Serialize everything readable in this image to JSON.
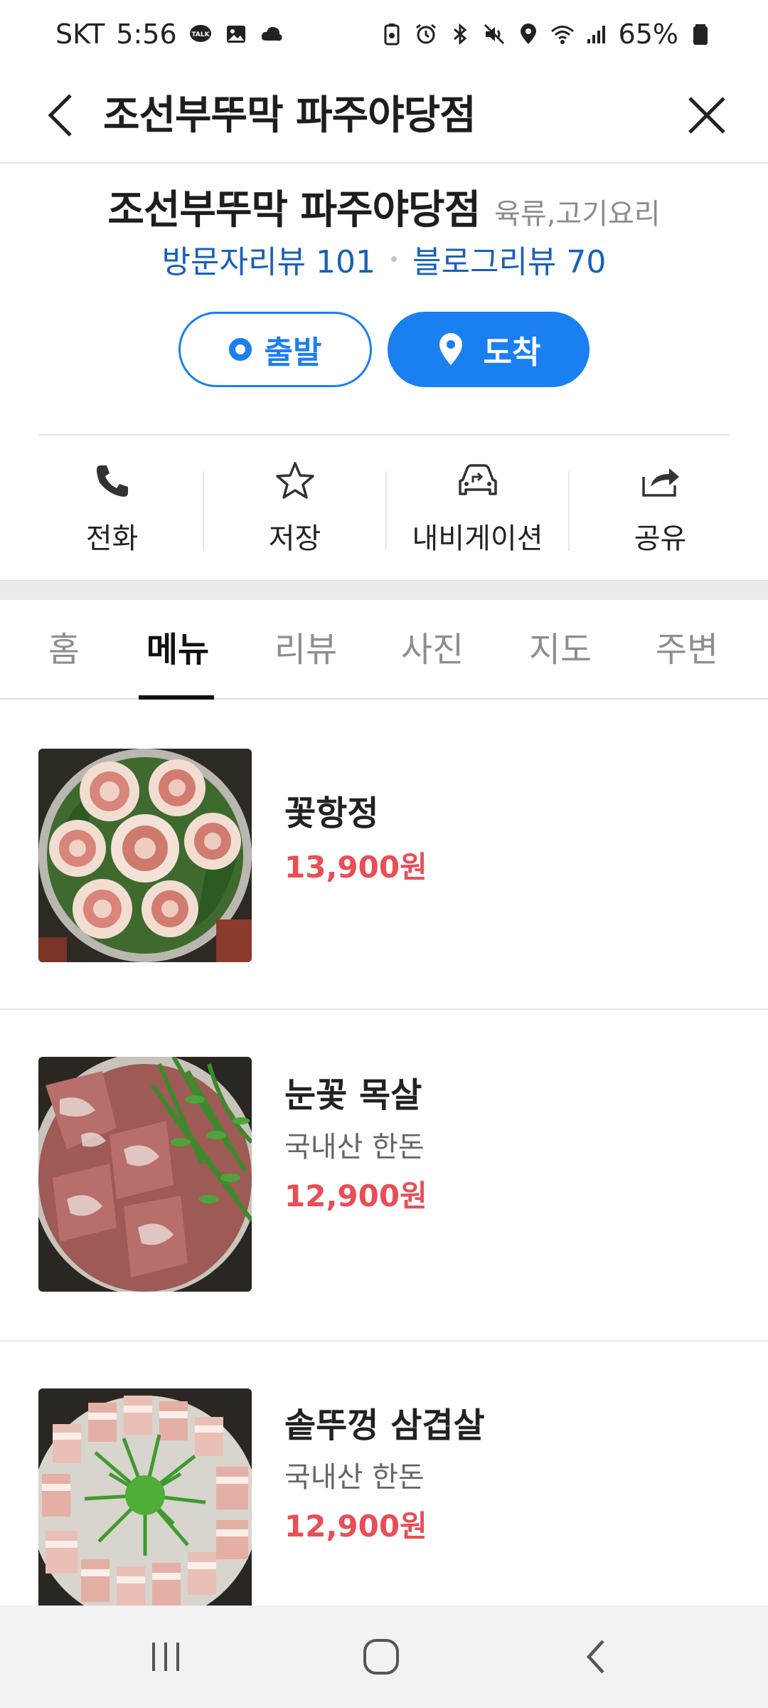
{
  "status_bar": {
    "carrier": "SKT",
    "time": "5:56",
    "battery": "65%",
    "left_icons": [
      "talk-icon",
      "gallery-icon",
      "cloud-icon"
    ],
    "right_icons": [
      "recycle-battery-icon",
      "alarm-icon",
      "bluetooth-icon",
      "mute-icon",
      "location-icon",
      "wifi-icon",
      "signal-icon",
      "battery-icon"
    ]
  },
  "header": {
    "title": "조선부뚜막 파주야당점"
  },
  "place": {
    "name": "조선부뚜막 파주야당점",
    "category": "육류,고기요리",
    "visitor_reviews": "방문자리뷰 101",
    "blog_reviews": "블로그리뷰 70",
    "depart_label": "출발",
    "arrive_label": "도착"
  },
  "actions": [
    {
      "label": "전화",
      "icon": "phone-icon"
    },
    {
      "label": "저장",
      "icon": "star-icon"
    },
    {
      "label": "내비게이션",
      "icon": "car-navigation-icon"
    },
    {
      "label": "공유",
      "icon": "share-icon"
    }
  ],
  "tabs": [
    "홈",
    "메뉴",
    "리뷰",
    "사진",
    "지도",
    "주변"
  ],
  "active_tab": "메뉴",
  "menu": [
    {
      "name": "꽃항정",
      "desc": "",
      "price": "13,900원"
    },
    {
      "name": "눈꽃 목살",
      "desc": "국내산 한돈",
      "price": "12,900원"
    },
    {
      "name": "솥뚜껑 삼겹살",
      "desc": "국내산 한돈",
      "price": "12,900원"
    }
  ],
  "colors": {
    "accent_blue": "#1a7ff0",
    "review_blue": "#1760b8",
    "price_red": "#e94e57"
  }
}
